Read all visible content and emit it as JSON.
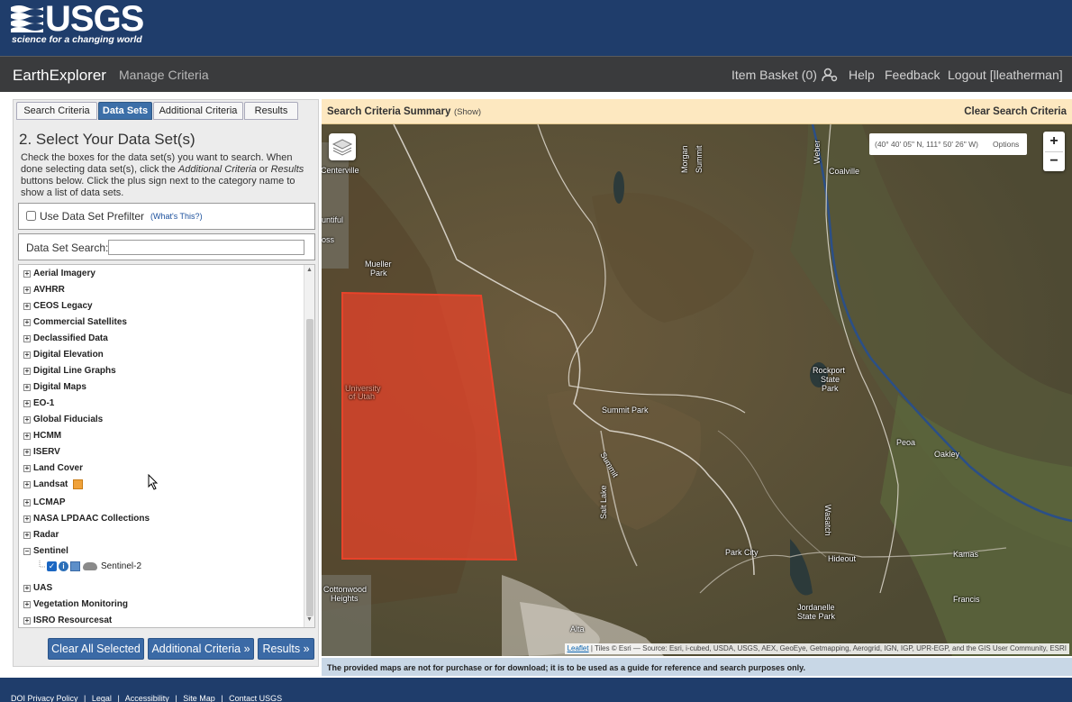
{
  "header": {
    "logo_text": "USGS",
    "tagline": "science for a changing world",
    "app_title": "EarthExplorer",
    "manage_criteria": "Manage Criteria",
    "item_basket": "Item Basket (0)",
    "help": "Help",
    "feedback": "Feedback",
    "logout": "Logout [lleatherman]"
  },
  "tabs": [
    {
      "label": "Search Criteria",
      "active": false
    },
    {
      "label": "Data Sets",
      "active": true
    },
    {
      "label": "Additional Criteria",
      "active": false
    },
    {
      "label": "Results",
      "active": false
    }
  ],
  "panel": {
    "step_title": "2. Select Your Data Set(s)",
    "description_part1": "Check the boxes for the data set(s) you want to search. When done selecting data set(s), click the ",
    "description_link1": "Additional Criteria",
    "description_mid": " or ",
    "description_link2": "Results",
    "description_part2": " buttons below. Click the plus sign next to the category name to show a list of data sets.",
    "prefilter_label": "Use Data Set Prefilter",
    "prefilter_checked": false,
    "whats_this": "(What's This?)",
    "search_label": "Data Set Search:",
    "search_value": "",
    "search_placeholder": ""
  },
  "tree": {
    "items": [
      {
        "label": "Aerial Imagery",
        "expander": "+"
      },
      {
        "label": "AVHRR",
        "expander": "+"
      },
      {
        "label": "CEOS Legacy",
        "expander": "+"
      },
      {
        "label": "Commercial Satellites",
        "expander": "+"
      },
      {
        "label": "Declassified Data",
        "expander": "+"
      },
      {
        "label": "Digital Elevation",
        "expander": "+"
      },
      {
        "label": "Digital Line Graphs",
        "expander": "+"
      },
      {
        "label": "Digital Maps",
        "expander": "+"
      },
      {
        "label": "EO-1",
        "expander": "+"
      },
      {
        "label": "Global Fiducials",
        "expander": "+"
      },
      {
        "label": "HCMM",
        "expander": "+"
      },
      {
        "label": "ISERV",
        "expander": "+"
      },
      {
        "label": "Land Cover",
        "expander": "+"
      },
      {
        "label": "Landsat",
        "expander": "+"
      },
      {
        "label": "LCMAP",
        "expander": "+"
      },
      {
        "label": "NASA LPDAAC Collections",
        "expander": "+"
      },
      {
        "label": "Radar",
        "expander": "+"
      },
      {
        "label": "Sentinel",
        "expander": "−"
      },
      {
        "label": "UAS",
        "expander": "+"
      },
      {
        "label": "Vegetation Monitoring",
        "expander": "+"
      },
      {
        "label": "ISRO Resourcesat",
        "expander": "+"
      }
    ],
    "sentinel_child": {
      "label": "Sentinel-2",
      "checked": true
    }
  },
  "buttons": {
    "clear": "Clear All Selected",
    "additional": "Additional Criteria »",
    "results": "Results »"
  },
  "summary": {
    "title": "Search Criteria Summary",
    "show": "(Show)",
    "clear": "Clear Search Criteria"
  },
  "map": {
    "coordinates": "(40° 40' 05\" N, 111° 50' 26\" W)",
    "options": "Options",
    "zoom_in": "+",
    "zoom_out": "−",
    "labels": {
      "centerville": "Centerville",
      "bountiful": "untiful",
      "cross": "oss",
      "mueller": "Mueller",
      "park": "Park",
      "morgan": "Morgan",
      "summit": "Summit",
      "coalville": "Coalville",
      "rockport1": "Rockport",
      "rockport2": "State",
      "rockport3": "Park",
      "university1": "University",
      "university2": "of Utah",
      "summit_park": "Summit Park",
      "summit_road": "Summit",
      "salt_lake": "Salt Lake",
      "peoa": "Peoa",
      "oakley": "Oakley",
      "wasatch": "Wasatch",
      "park_city": "Park City",
      "hideout": "Hideout",
      "kamas": "Kamas",
      "francis": "Francis",
      "cottonwood1": "Cottonwood",
      "cottonwood2": "Heights",
      "jordanelle1": "Jordanelle",
      "jordanelle2": "State Park",
      "alta": "Alta",
      "weber": "Weber"
    },
    "attribution_link": "Leaflet",
    "attribution_text": " | Tiles © Esri — Source: Esri, i-cubed, USDA, USGS, AEX, GeoEye, Getmapping, Aerogrid, IGN, IGP, UPR-EGP, and the GIS User Community, ESRI"
  },
  "disclaimer": "The provided maps are not for purchase or for download; it is to be used as a guide for reference and search purposes only.",
  "footer": {
    "links": [
      "DOI Privacy Policy",
      "|",
      "Legal",
      "|",
      "Accessibility",
      "|",
      "Site Map",
      "|",
      "Contact USGS"
    ]
  },
  "colors": {
    "usgs_blue": "#1f3d6b",
    "nav_dark": "#3a3b3d",
    "active_tab": "#3c6fa8",
    "aoi_fill": "#e8432a",
    "summary_bg": "#fde8c0"
  }
}
